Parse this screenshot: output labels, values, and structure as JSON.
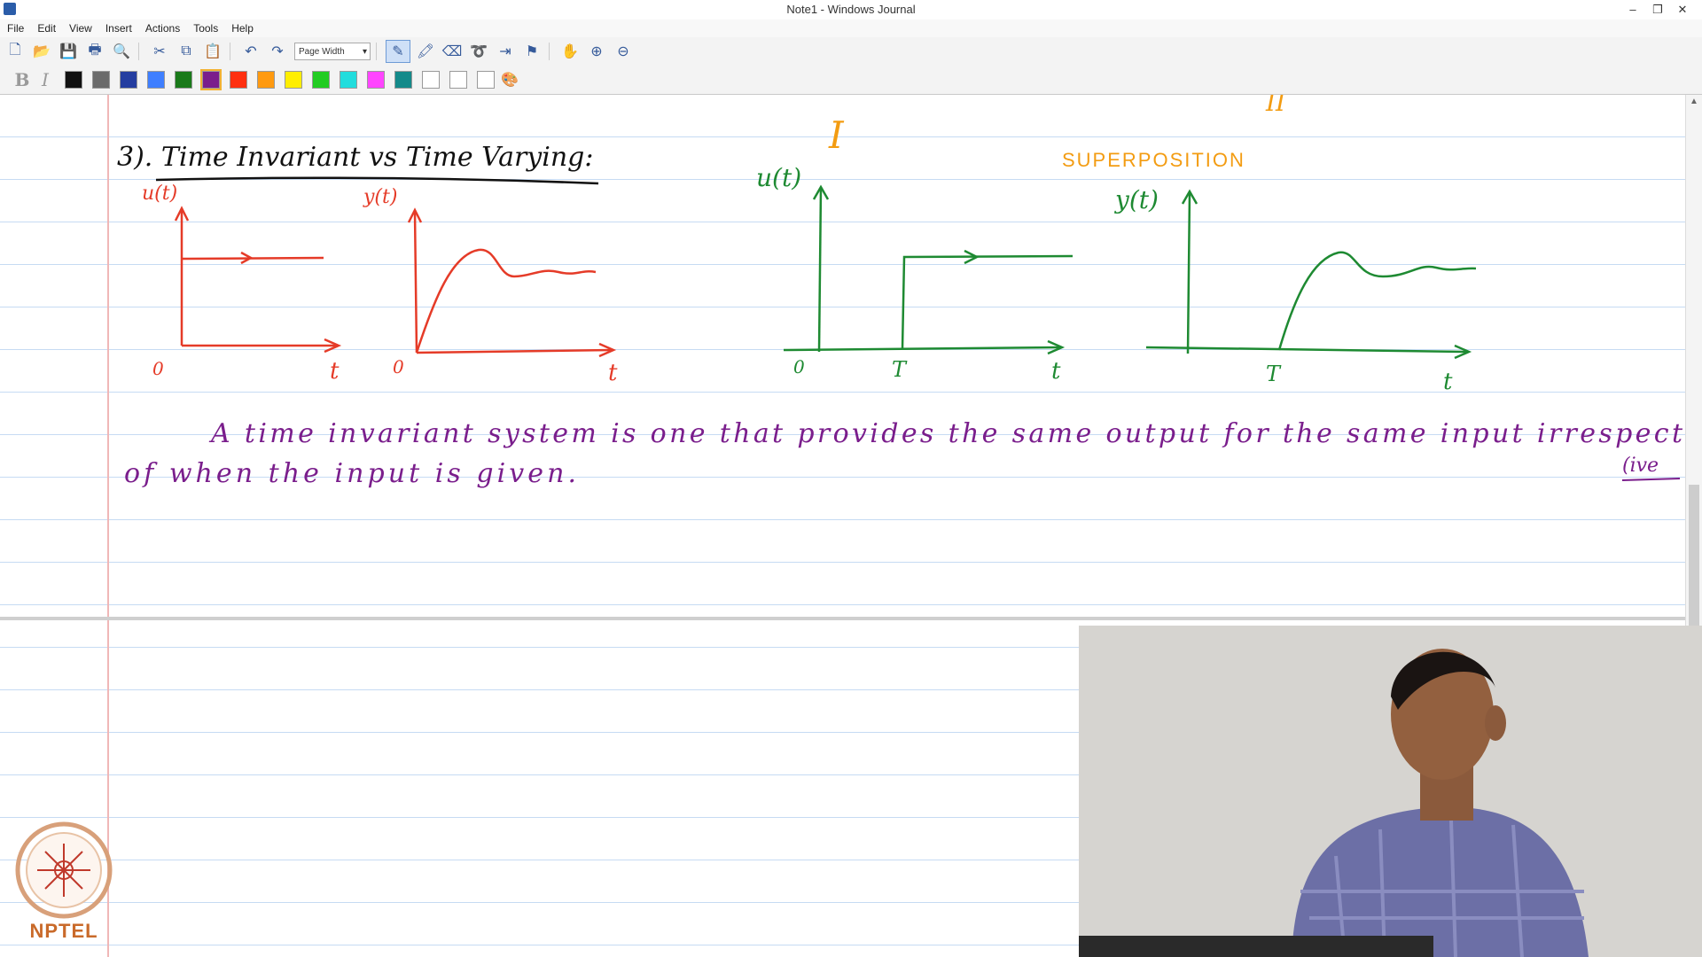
{
  "window": {
    "title": "Note1 - Windows Journal",
    "controls": [
      "–",
      "❐",
      "✕"
    ]
  },
  "menu": [
    "File",
    "Edit",
    "View",
    "Insert",
    "Actions",
    "Tools",
    "Help"
  ],
  "toolbar": {
    "zoom_value": "Page Width"
  },
  "colors": [
    "#111111",
    "#6b6b6b",
    "#253ea0",
    "#3f7fff",
    "#1a7a1a",
    "#7a1e8c",
    "#ff3010",
    "#ff9a10",
    "#ffee00",
    "#22cc22",
    "#22dddd",
    "#ff44ff",
    "#148a8a",
    "#ffffff",
    "#ffffff",
    "#ffffff"
  ],
  "note": {
    "heading": "3). Time Invariant vs Time Varying:",
    "label_I": "I",
    "label_II": "II",
    "superposition": "SUPERPOSITION",
    "red_plot1": {
      "ylabel": "u(t)",
      "origin": "0",
      "xlabel": "t"
    },
    "red_plot2": {
      "ylabel": "y(t)",
      "origin": "0",
      "xlabel": "t"
    },
    "green_plot1": {
      "ylabel": "u(t)",
      "origin": "0",
      "tick": "T",
      "xlabel": "t"
    },
    "green_plot2": {
      "ylabel": "y(t)",
      "tick": "T",
      "xlabel": "t"
    },
    "sentence_line1": "A time invariant system is one that provides the same output for the same input irrespect",
    "sentence_line2": "of when the input is given.",
    "margin_note": "(ive"
  },
  "logo": {
    "text": "NPTEL"
  }
}
